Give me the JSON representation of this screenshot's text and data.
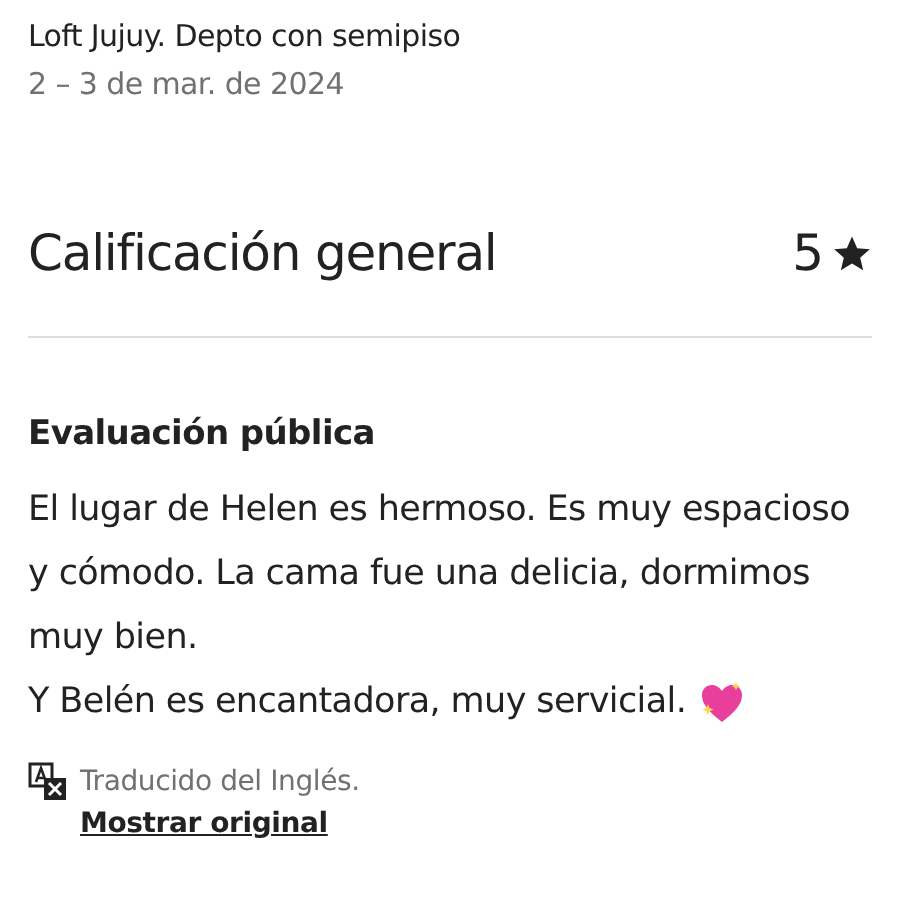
{
  "listing": {
    "title": "Loft Jujuy. Depto con semipiso",
    "dates": "2 – 3 de mar. de 2024"
  },
  "overall_rating": {
    "label": "Calificación general",
    "value": "5"
  },
  "public_review": {
    "heading": "Evaluación pública",
    "paragraphs": [
      "El lugar de Helen es hermoso. Es muy espacioso y cómodo. La cama fue una delicia, dormimos muy bien.",
      "Y Belén es encantadora, muy servicial."
    ]
  },
  "translation": {
    "note": "Traducido del Inglés.",
    "link": "Mostrar original"
  }
}
